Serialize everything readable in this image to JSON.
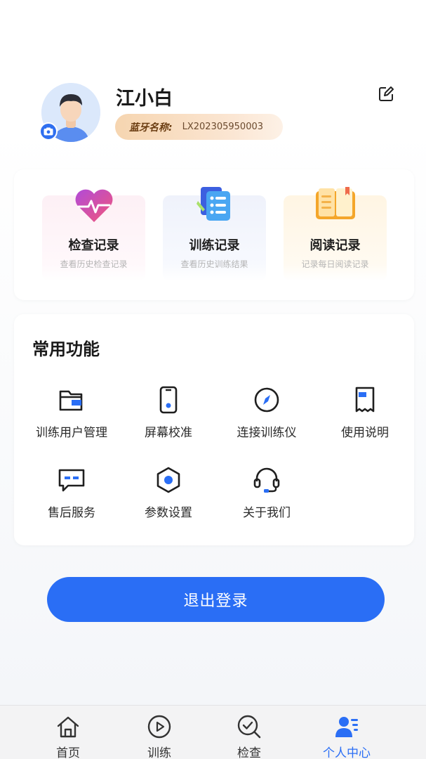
{
  "profile": {
    "username": "江小白",
    "bluetooth_label": "蓝牙名称:",
    "bluetooth_value": "LX202305950003"
  },
  "records": [
    {
      "title": "检查记录",
      "subtitle": "查看历史检查记录",
      "icon": "heart-pulse-icon"
    },
    {
      "title": "训练记录",
      "subtitle": "查看历史训练结果",
      "icon": "checklist-icon"
    },
    {
      "title": "阅读记录",
      "subtitle": "记录每日阅读记录",
      "icon": "open-book-icon"
    }
  ],
  "functions": {
    "title": "常用功能",
    "items": [
      {
        "label": "训练用户管理",
        "icon": "folder-icon"
      },
      {
        "label": "屏幕校准",
        "icon": "phone-icon"
      },
      {
        "label": "连接训练仪",
        "icon": "compass-icon"
      },
      {
        "label": "使用说明",
        "icon": "receipt-icon"
      },
      {
        "label": "售后服务",
        "icon": "chat-icon"
      },
      {
        "label": "参数设置",
        "icon": "hexagon-settings-icon"
      },
      {
        "label": "关于我们",
        "icon": "headset-icon"
      }
    ]
  },
  "logout_label": "退出登录",
  "tabs": [
    {
      "label": "首页",
      "icon": "home-icon",
      "active": false
    },
    {
      "label": "训练",
      "icon": "play-icon",
      "active": false
    },
    {
      "label": "检查",
      "icon": "check-search-icon",
      "active": false
    },
    {
      "label": "个人中心",
      "icon": "user-center-icon",
      "active": true
    }
  ],
  "colors": {
    "accent": "#2a6ef5",
    "pill": "#f6d5b0"
  }
}
